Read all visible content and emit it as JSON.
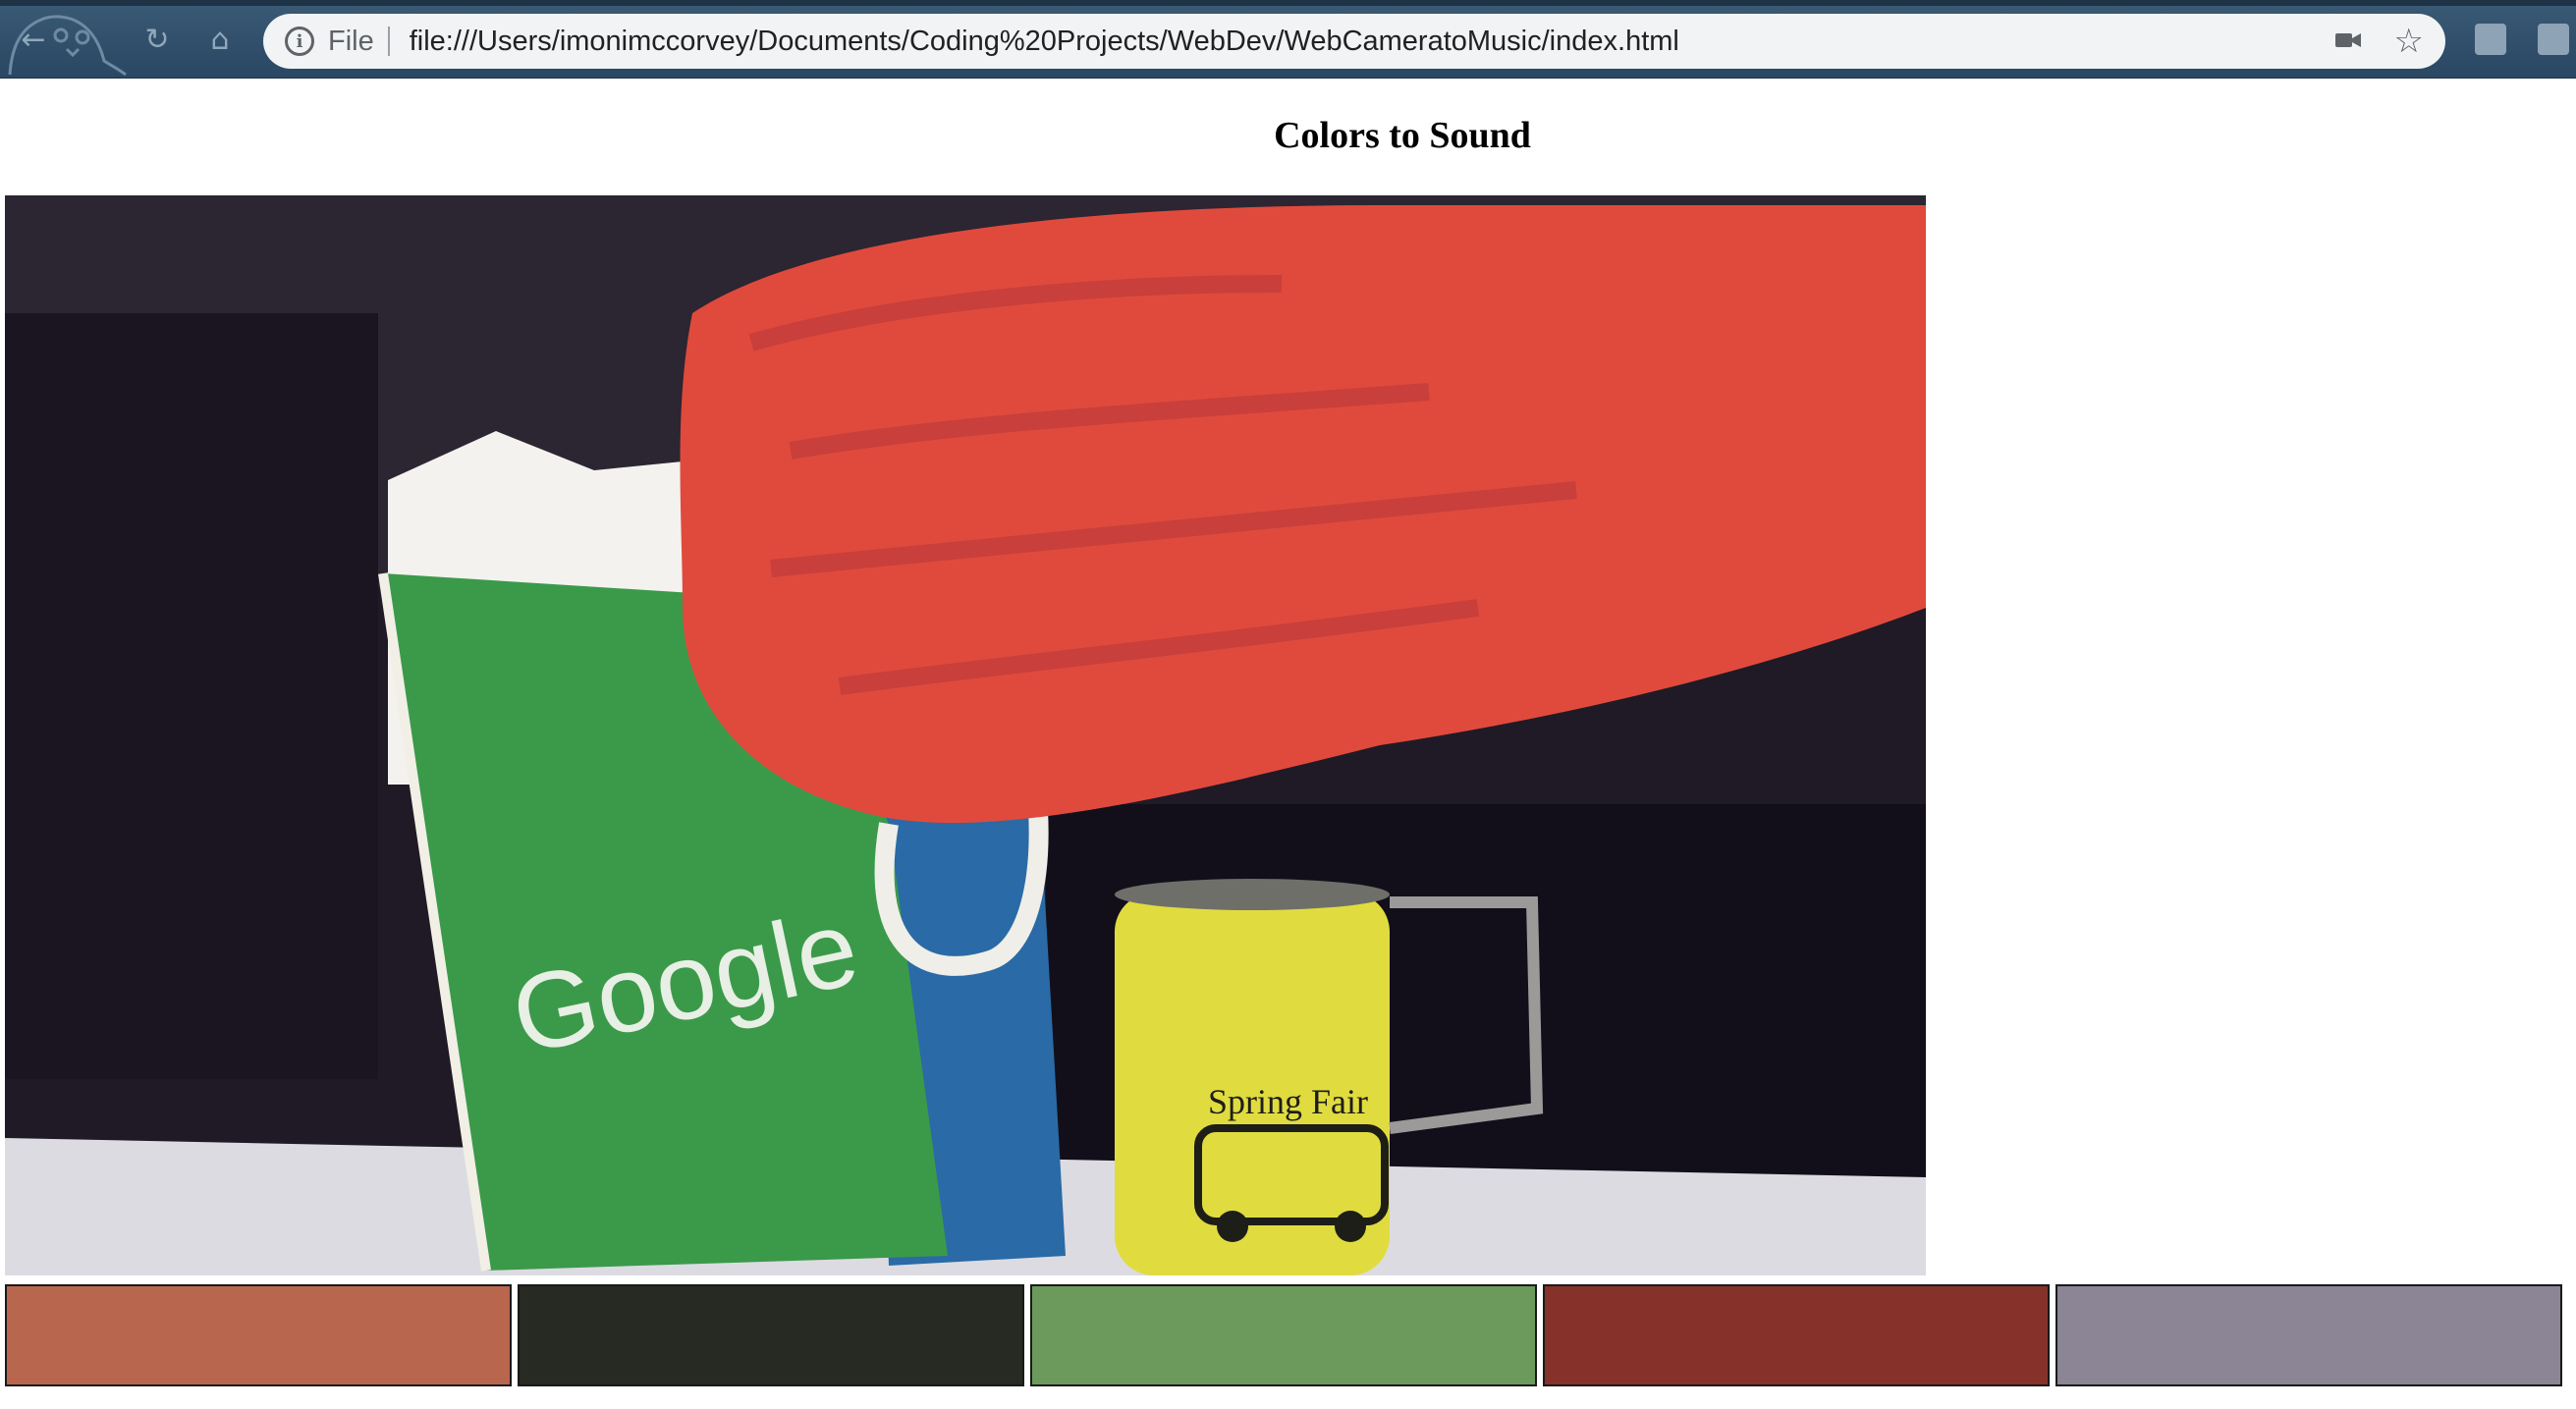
{
  "browser": {
    "file_label": "File",
    "url": "file:///Users/imonimccorvey/Documents/Coding%20Projects/WebDev/WebCameratoMusic/index.html",
    "icons": [
      "back-icon",
      "reload-icon",
      "home-icon",
      "info-icon",
      "camera-icon",
      "star-icon"
    ]
  },
  "page": {
    "title": "Colors to Sound"
  },
  "video": {
    "bag_text": "Google",
    "mug_text": "Spring Fair"
  },
  "swatches": [
    {
      "name": "swatch-1",
      "color": "#b9664e"
    },
    {
      "name": "swatch-2",
      "color": "#262a23"
    },
    {
      "name": "swatch-3",
      "color": "#6b9a5c"
    },
    {
      "name": "swatch-4",
      "color": "#86312a"
    },
    {
      "name": "swatch-5",
      "color": "#8b8595"
    }
  ]
}
